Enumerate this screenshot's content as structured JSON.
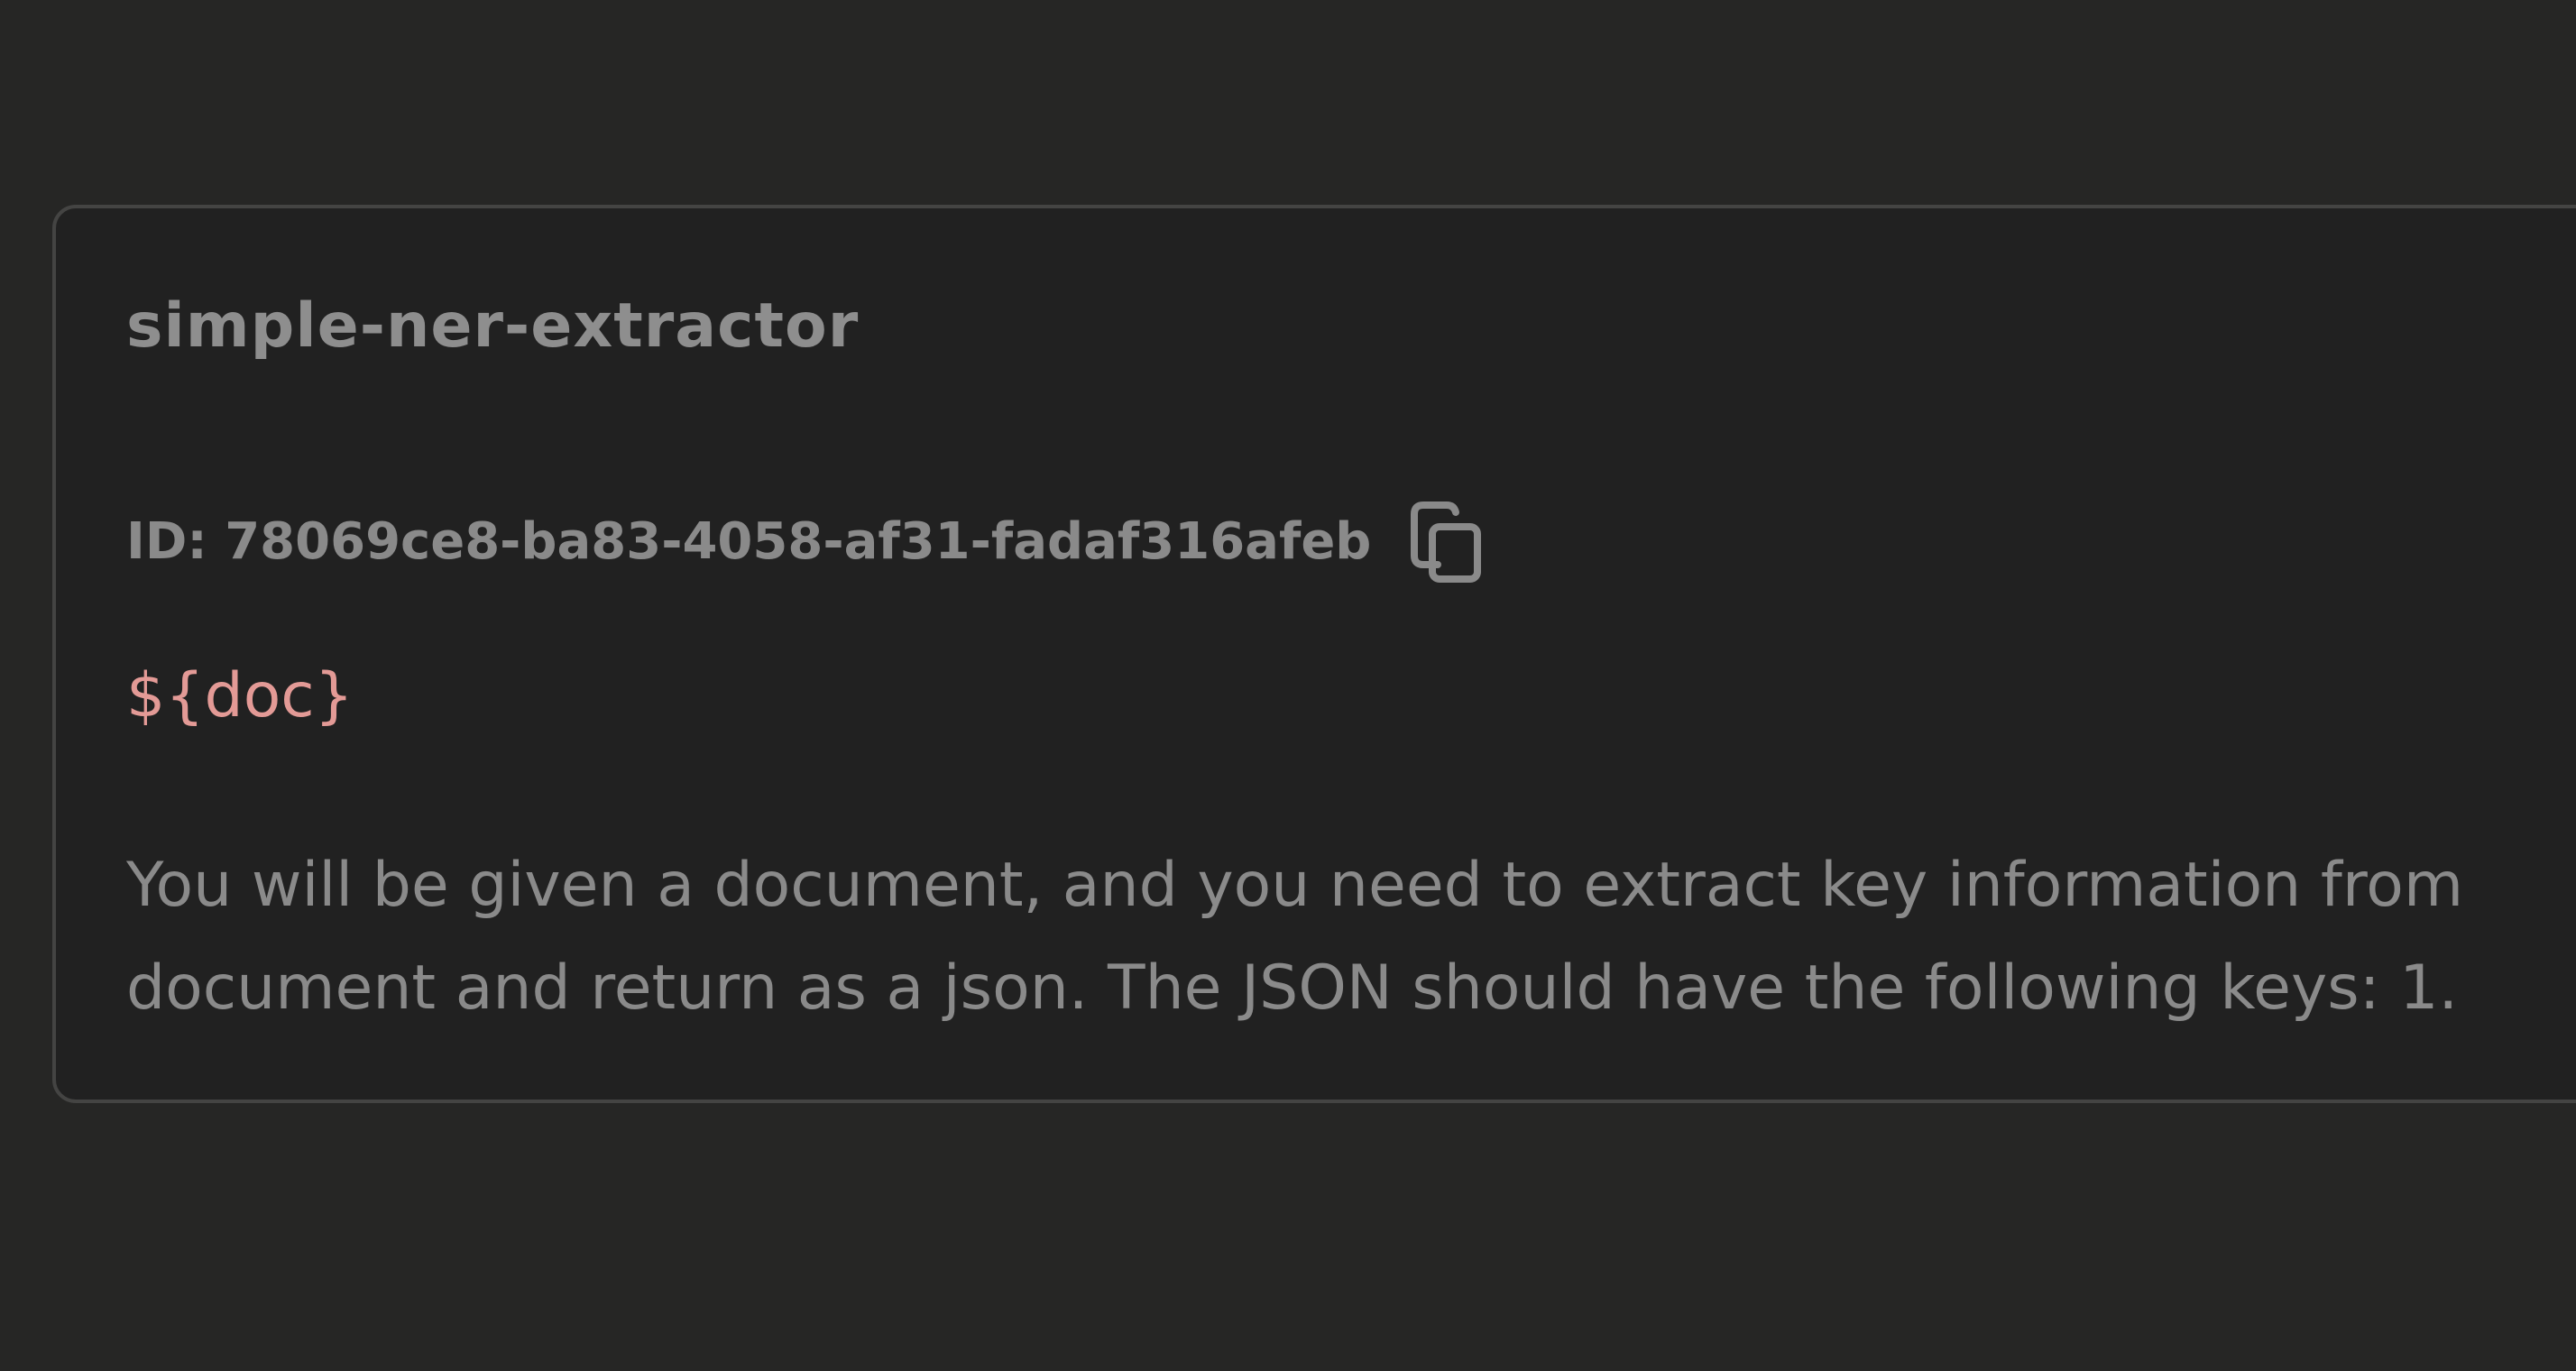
{
  "card": {
    "title": "simple-ner-extractor",
    "id_text": "ID: 78069ce8-ba83-4058-af31-fadaf316afeb",
    "copy_icon": "copy-icon",
    "variable": "${doc}",
    "description_lines": [
      "You will be given a document, and you need to extract key information from",
      "document and return as a json. The JSON should have the following keys: 1."
    ]
  },
  "colors": {
    "background": "#262625",
    "card_background": "#212121",
    "card_border": "#444443",
    "text_muted": "#8a8a8a",
    "variable_accent": "#e39a96"
  }
}
